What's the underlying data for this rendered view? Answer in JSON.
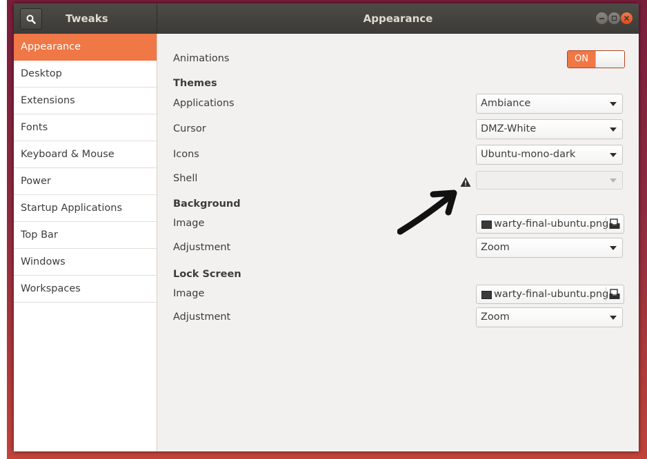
{
  "app": {
    "sidebar_title": "Tweaks",
    "window_title": "Appearance"
  },
  "sidebar": {
    "items": [
      {
        "label": "Appearance",
        "selected": true
      },
      {
        "label": "Desktop"
      },
      {
        "label": "Extensions"
      },
      {
        "label": "Fonts"
      },
      {
        "label": "Keyboard & Mouse"
      },
      {
        "label": "Power"
      },
      {
        "label": "Startup Applications"
      },
      {
        "label": "Top Bar"
      },
      {
        "label": "Windows"
      },
      {
        "label": "Workspaces"
      }
    ]
  },
  "appearance": {
    "animations": {
      "label": "Animations",
      "toggle_text": "ON",
      "enabled": true
    },
    "themes": {
      "heading": "Themes",
      "applications": {
        "label": "Applications",
        "value": "Ambiance"
      },
      "cursor": {
        "label": "Cursor",
        "value": "DMZ-White"
      },
      "icons": {
        "label": "Icons",
        "value": "Ubuntu-mono-dark"
      },
      "shell": {
        "label": "Shell",
        "value": "",
        "warning_icon": "warning-icon",
        "disabled": true
      }
    },
    "background": {
      "heading": "Background",
      "image": {
        "label": "Image",
        "value": "warty-final-ubuntu.png"
      },
      "adjustment": {
        "label": "Adjustment",
        "value": "Zoom"
      }
    },
    "lock_screen": {
      "heading": "Lock Screen",
      "image": {
        "label": "Image",
        "value": "warty-final-ubuntu.png"
      },
      "adjustment": {
        "label": "Adjustment",
        "value": "Zoom"
      }
    }
  },
  "colors": {
    "accent": "#f07746",
    "titlebar": "#3c3b37",
    "close_button": "#df4a16"
  }
}
